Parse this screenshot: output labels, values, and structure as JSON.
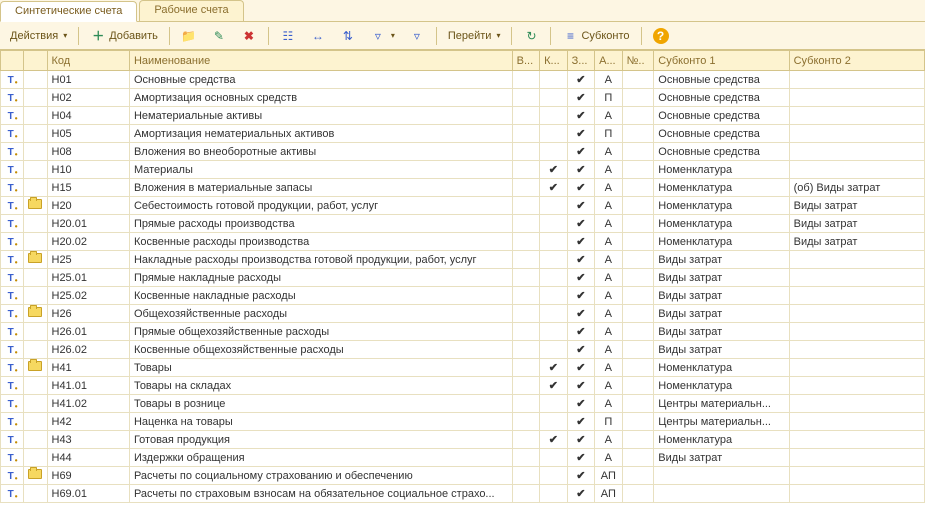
{
  "tabs": [
    {
      "label": "Синтетические счета",
      "active": true
    },
    {
      "label": "Рабочие счета",
      "active": false
    }
  ],
  "toolbar": {
    "actions_label": "Действия",
    "add_label": "Добавить",
    "goto_label": "Перейти",
    "subkonto_label": "Субконто"
  },
  "columns": {
    "code": "Код",
    "name": "Наименование",
    "v": "В...",
    "k": "К...",
    "z": "З...",
    "a": "А...",
    "n": "№..",
    "sub1": "Субконто 1",
    "sub2": "Субконто 2"
  },
  "rows": [
    {
      "folder": false,
      "code": "Н01",
      "name": "Основные средства",
      "v": false,
      "k": false,
      "z": true,
      "a": "А",
      "n": "",
      "sub1": "Основные средства",
      "sub2": ""
    },
    {
      "folder": false,
      "code": "Н02",
      "name": "Амортизация основных средств",
      "v": false,
      "k": false,
      "z": true,
      "a": "П",
      "n": "",
      "sub1": "Основные средства",
      "sub2": ""
    },
    {
      "folder": false,
      "code": "Н04",
      "name": "Нематериальные активы",
      "v": false,
      "k": false,
      "z": true,
      "a": "А",
      "n": "",
      "sub1": "Основные средства",
      "sub2": ""
    },
    {
      "folder": false,
      "code": "Н05",
      "name": "Амортизация нематериальных активов",
      "v": false,
      "k": false,
      "z": true,
      "a": "П",
      "n": "",
      "sub1": "Основные средства",
      "sub2": ""
    },
    {
      "folder": false,
      "code": "Н08",
      "name": "Вложения во внеоборотные активы",
      "v": false,
      "k": false,
      "z": true,
      "a": "А",
      "n": "",
      "sub1": "Основные средства",
      "sub2": ""
    },
    {
      "folder": false,
      "code": "Н10",
      "name": "Материалы",
      "v": false,
      "k": true,
      "z": true,
      "a": "А",
      "n": "",
      "sub1": "Номенклатура",
      "sub2": ""
    },
    {
      "folder": false,
      "code": "Н15",
      "name": "Вложения в материальные запасы",
      "v": false,
      "k": true,
      "z": true,
      "a": "А",
      "n": "",
      "sub1": "Номенклатура",
      "sub2": "(об) Виды затрат"
    },
    {
      "folder": true,
      "code": "Н20",
      "name": "Себестоимость готовой продукции, работ, услуг",
      "v": false,
      "k": false,
      "z": true,
      "a": "А",
      "n": "",
      "sub1": "Номенклатура",
      "sub2": "Виды затрат"
    },
    {
      "folder": false,
      "code": "Н20.01",
      "name": "Прямые расходы производства",
      "v": false,
      "k": false,
      "z": true,
      "a": "А",
      "n": "",
      "sub1": "Номенклатура",
      "sub2": "Виды затрат"
    },
    {
      "folder": false,
      "code": "Н20.02",
      "name": "Косвенные расходы производства",
      "v": false,
      "k": false,
      "z": true,
      "a": "А",
      "n": "",
      "sub1": "Номенклатура",
      "sub2": "Виды затрат"
    },
    {
      "folder": true,
      "code": "Н25",
      "name": "Накладные расходы производства готовой продукции, работ, услуг",
      "v": false,
      "k": false,
      "z": true,
      "a": "А",
      "n": "",
      "sub1": "Виды затрат",
      "sub2": ""
    },
    {
      "folder": false,
      "code": "Н25.01",
      "name": "Прямые накладные расходы",
      "v": false,
      "k": false,
      "z": true,
      "a": "А",
      "n": "",
      "sub1": "Виды затрат",
      "sub2": ""
    },
    {
      "folder": false,
      "code": "Н25.02",
      "name": "Косвенные накладные расходы",
      "v": false,
      "k": false,
      "z": true,
      "a": "А",
      "n": "",
      "sub1": "Виды затрат",
      "sub2": ""
    },
    {
      "folder": true,
      "code": "Н26",
      "name": "Общехозяйственные расходы",
      "v": false,
      "k": false,
      "z": true,
      "a": "А",
      "n": "",
      "sub1": "Виды затрат",
      "sub2": ""
    },
    {
      "folder": false,
      "code": "Н26.01",
      "name": "Прямые общехозяйственные расходы",
      "v": false,
      "k": false,
      "z": true,
      "a": "А",
      "n": "",
      "sub1": "Виды затрат",
      "sub2": ""
    },
    {
      "folder": false,
      "code": "Н26.02",
      "name": "Косвенные общехозяйственные расходы",
      "v": false,
      "k": false,
      "z": true,
      "a": "А",
      "n": "",
      "sub1": "Виды затрат",
      "sub2": ""
    },
    {
      "folder": true,
      "code": "Н41",
      "name": "Товары",
      "v": false,
      "k": true,
      "z": true,
      "a": "А",
      "n": "",
      "sub1": "Номенклатура",
      "sub2": ""
    },
    {
      "folder": false,
      "code": "Н41.01",
      "name": "Товары на складах",
      "v": false,
      "k": true,
      "z": true,
      "a": "А",
      "n": "",
      "sub1": "Номенклатура",
      "sub2": ""
    },
    {
      "folder": false,
      "code": "Н41.02",
      "name": "Товары в рознице",
      "v": false,
      "k": false,
      "z": true,
      "a": "А",
      "n": "",
      "sub1": "Центры материальн...",
      "sub2": ""
    },
    {
      "folder": false,
      "code": "Н42",
      "name": "Наценка на товары",
      "v": false,
      "k": false,
      "z": true,
      "a": "П",
      "n": "",
      "sub1": "Центры материальн...",
      "sub2": ""
    },
    {
      "folder": false,
      "code": "Н43",
      "name": "Готовая продукция",
      "v": false,
      "k": true,
      "z": true,
      "a": "А",
      "n": "",
      "sub1": "Номенклатура",
      "sub2": ""
    },
    {
      "folder": false,
      "code": "Н44",
      "name": "Издержки обращения",
      "v": false,
      "k": false,
      "z": true,
      "a": "А",
      "n": "",
      "sub1": "Виды затрат",
      "sub2": ""
    },
    {
      "folder": true,
      "code": "Н69",
      "name": "Расчеты по социальному страхованию и обеспечению",
      "v": false,
      "k": false,
      "z": true,
      "a": "АП",
      "n": "",
      "sub1": "",
      "sub2": ""
    },
    {
      "folder": false,
      "code": "Н69.01",
      "name": "Расчеты по страховым взносам на обязательное социальное страхо...",
      "v": false,
      "k": false,
      "z": true,
      "a": "АП",
      "n": "",
      "sub1": "",
      "sub2": ""
    }
  ]
}
